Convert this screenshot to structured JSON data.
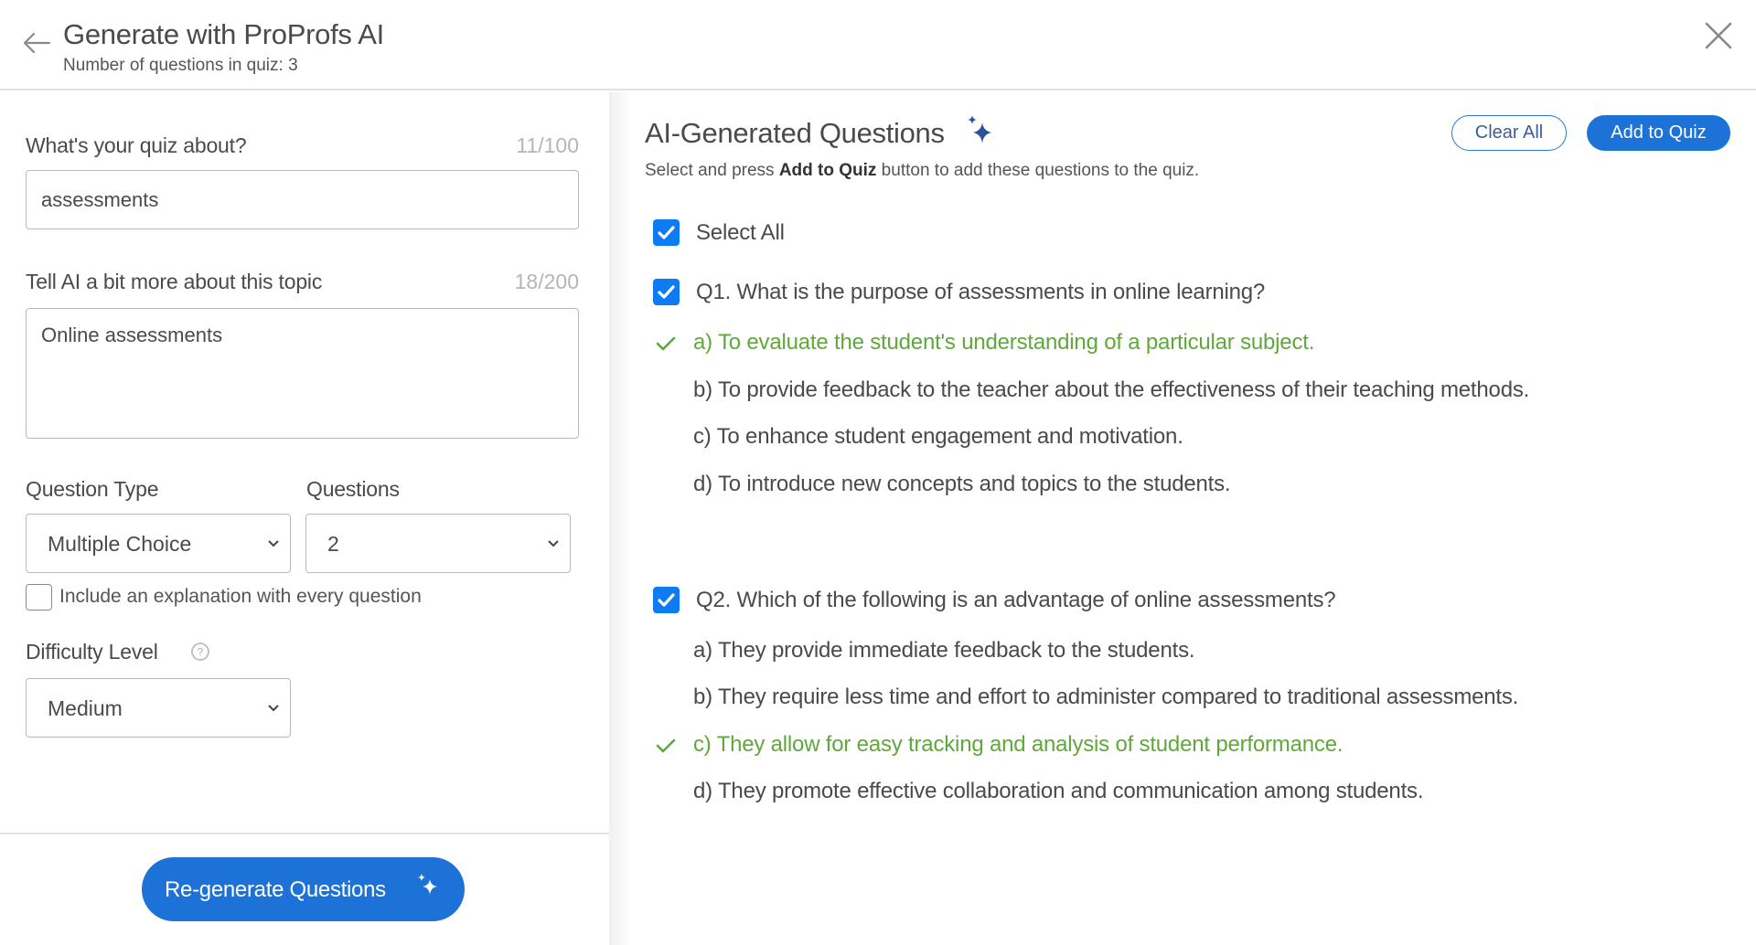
{
  "header": {
    "title": "Generate with ProProfs AI",
    "subtitle": "Number of questions in quiz: 3",
    "back_icon": "arrow-left-icon",
    "close_icon": "close-icon"
  },
  "form": {
    "topic": {
      "label": "What's your quiz about?",
      "counter": "11/100",
      "value": "assessments"
    },
    "details": {
      "label": "Tell AI a bit more about this topic",
      "counter": "18/200",
      "value": "Online assessments"
    },
    "question_type": {
      "label": "Question Type",
      "selected": "Multiple Choice"
    },
    "questions_count": {
      "label": "Questions",
      "selected": "2"
    },
    "explanation": {
      "label": "Include an explanation with every question",
      "checked": false
    },
    "difficulty": {
      "label": "Difficulty Level",
      "selected": "Medium",
      "help_icon": "help-circle-icon"
    },
    "regenerate_label": "Re-generate Questions"
  },
  "results": {
    "title": "AI-Generated Questions",
    "subtitle_pre": "Select and press ",
    "subtitle_bold": "Add to Quiz",
    "subtitle_post": " button to add these questions to the quiz.",
    "clear_all_label": "Clear All",
    "add_to_quiz_label": "Add to Quiz",
    "select_all_label": "Select All",
    "select_all_checked": true,
    "accent_color": "#1c72d6",
    "correct_color": "#5fa83a",
    "questions": [
      {
        "text": "Q1. What is the purpose of assessments in online learning?",
        "checked": true,
        "options": [
          {
            "text": "a) To evaluate the student's understanding of a particular subject.",
            "correct": true
          },
          {
            "text": "b) To provide feedback to the teacher about the effectiveness of their teaching methods.",
            "correct": false
          },
          {
            "text": "c) To enhance student engagement and motivation.",
            "correct": false
          },
          {
            "text": "d) To introduce new concepts and topics to the students.",
            "correct": false
          }
        ]
      },
      {
        "text": "Q2. Which of the following is an advantage of online assessments?",
        "checked": true,
        "options": [
          {
            "text": "a) They provide immediate feedback to the students.",
            "correct": false
          },
          {
            "text": "b) They require less time and effort to administer compared to traditional assessments.",
            "correct": false
          },
          {
            "text": "c) They allow for easy tracking and analysis of student performance.",
            "correct": true
          },
          {
            "text": "d) They promote effective collaboration and communication among students.",
            "correct": false
          }
        ]
      }
    ]
  }
}
